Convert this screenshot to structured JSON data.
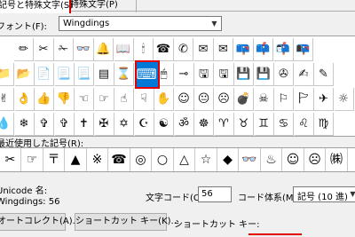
{
  "tabs": {
    "symbols": "記号と特殊文字(S)",
    "special": "特殊文字(P)"
  },
  "font": {
    "label": "フォント(F):",
    "value": "Wingdings"
  },
  "grid_rows": [
    [
      "✏",
      "✂",
      "✁",
      "👓",
      "🔔",
      "📖",
      "🕯",
      "☎",
      "✆",
      "✉",
      "✉",
      "📪",
      "📫",
      "📬",
      "📭"
    ],
    [
      "📁",
      "📂",
      "📄",
      "📃",
      "📃",
      "▤",
      "⌛",
      "⌨",
      "🖱",
      "⊸",
      "🖫",
      "🖫",
      "💾",
      "💾",
      "✇",
      "✍",
      "✎"
    ],
    [
      "✌",
      "👌",
      "👍",
      "👎",
      "☜",
      "☞",
      "☝",
      "☟",
      "✋",
      "☺",
      "😐",
      "☹",
      "💣",
      "☠",
      "⚐",
      "🏱",
      "✈",
      "☼"
    ],
    [
      "💧",
      "❄",
      "✞",
      "✞",
      "✝",
      "✠",
      "✡",
      "☪",
      "☯",
      "ॐ",
      "☸",
      "♈",
      "♉",
      "♊",
      "♋",
      "♌",
      "♍"
    ]
  ],
  "selected_symbol": "🖫",
  "recent": {
    "label": "最近使用した記号(R):",
    "items": [
      "✂",
      "☞",
      "〒",
      "▲",
      "※",
      "☎",
      "◎",
      "○",
      "△",
      "☆",
      "◆",
      "👓",
      "♨",
      "☺",
      "☹",
      "㈱"
    ]
  },
  "unicode": {
    "label": "Unicode 名:",
    "value": "Wingdings: 56"
  },
  "charcode": {
    "label": "文字コード(C):",
    "value": "56"
  },
  "codesys": {
    "label": "コード体系(M):",
    "value": "記号 (10 進)"
  },
  "buttons": {
    "autocorrect": "オートコレクト(A)...",
    "shortcut_key": "ショートカット キー(K)...",
    "shortcut_label": "ショートカット キー:"
  }
}
